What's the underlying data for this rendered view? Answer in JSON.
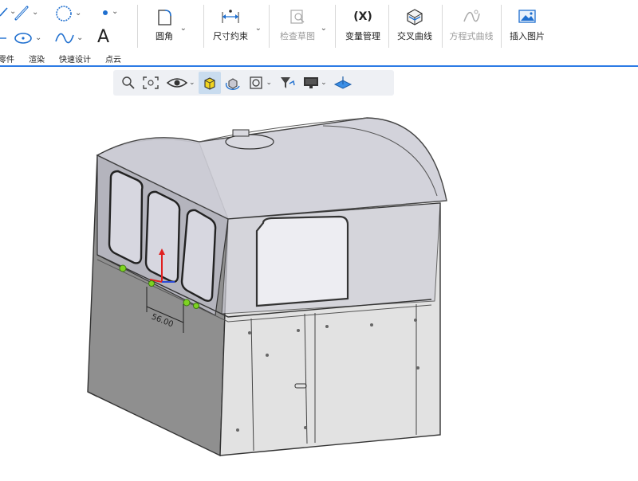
{
  "ribbon": {
    "tools": {
      "fillet_label": "圆角",
      "dimension_label": "尺寸约束",
      "check_sketch_label": "检查草图",
      "variable_label": "变量管理",
      "variable_icon_text": "(X)",
      "intersect_curve_label": "交叉曲线",
      "equation_curve_label": "方程式曲线",
      "insert_image_label": "插入图片"
    },
    "sketch_text_tool": "A",
    "tabs": [
      "零件",
      "渲染",
      "快速设计",
      "点云"
    ]
  },
  "viewbar": {
    "icons": [
      "zoom-icon",
      "zoom-fit-icon",
      "view-eye-icon",
      "shaded-cube-icon",
      "rotate-view-icon",
      "section-view-icon",
      "filter-icon",
      "display-monitor-icon",
      "plane-icon"
    ]
  },
  "viewport": {
    "dimension_value": "56.00",
    "colors": {
      "body": "#8c8c8c",
      "glass": "#c8c8d2",
      "accent": "#2c7be5",
      "anchor": "#7ed321"
    }
  }
}
